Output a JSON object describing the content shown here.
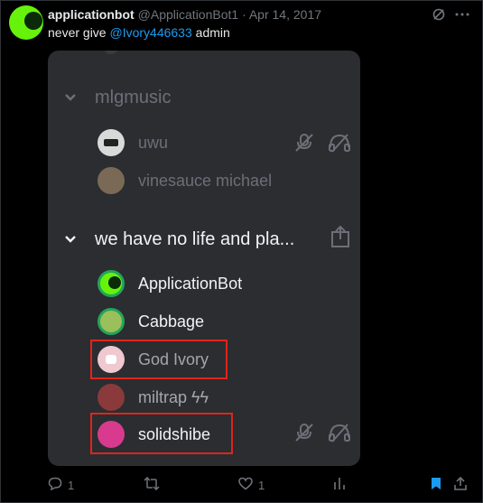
{
  "tweet": {
    "display_name": "applicationbot",
    "meta": "@ApplicationBot1 · Apr 14, 2017",
    "text_before": "never give ",
    "mention": "@Ivory446633",
    "text_after": " admin",
    "grok_icon": "grok-icon",
    "more_icon": "more-icon"
  },
  "embed": {
    "sections": [
      {
        "name": "mlgmusic",
        "state": "muted",
        "users": [
          {
            "name": "uwu",
            "muted": true,
            "deafened": true
          },
          {
            "name": "vinesauce michael"
          }
        ]
      },
      {
        "name": "we have no life and pla...",
        "state": "active",
        "users": [
          {
            "name": "ApplicationBot"
          },
          {
            "name": "Cabbage"
          },
          {
            "name": "God Ivory",
            "highlighted": true
          },
          {
            "name": "miltrap ϟϟ"
          },
          {
            "name": "solidshibe",
            "highlighted": true,
            "muted": true,
            "deafened": true
          }
        ]
      }
    ]
  },
  "actions": {
    "reply_count": "1",
    "retweet_count": "",
    "like_count": "1",
    "views_count": "",
    "bookmark_active": true
  },
  "colors": {
    "accent": "#1d9bf0",
    "highlight_box": "#e1241a",
    "discord_bg": "#2b2d31"
  }
}
